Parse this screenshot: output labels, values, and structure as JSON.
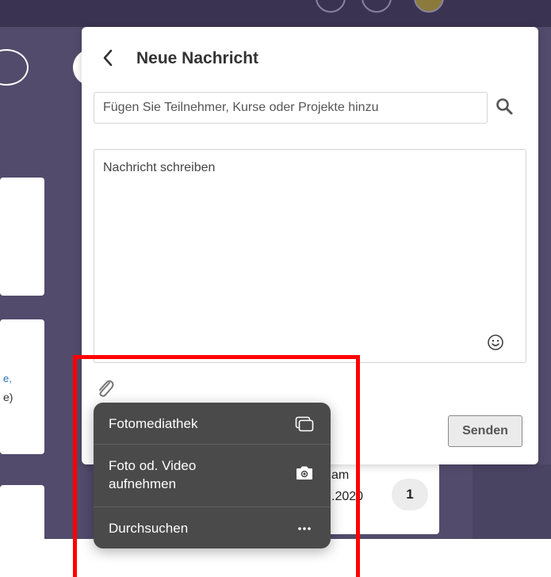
{
  "compose": {
    "title": "Neue Nachricht",
    "recipient_placeholder": "Fügen Sie Teilnehmer, Kurse oder Projekte hinzu",
    "message_placeholder": "Nachricht schreiben",
    "send_label": "Senden"
  },
  "attach_menu": {
    "items": [
      {
        "label": "Fotomediathek",
        "icon": "photo-library-icon"
      },
      {
        "label": "Foto od. Video aufnehmen",
        "icon": "camera-icon"
      },
      {
        "label": "Durchsuchen",
        "icon": "more-icon"
      }
    ]
  },
  "background": {
    "left_snippet_1": "e,",
    "left_snippet_2": "e)",
    "card_text_line1": "am",
    "card_text_line2": ".2020",
    "badge_count": "1"
  },
  "colors": {
    "background": "#524b6c",
    "menu_background": "#4a4a4a",
    "highlight": "#ff0000"
  }
}
